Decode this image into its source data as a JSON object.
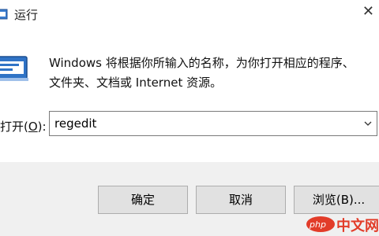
{
  "window": {
    "title": "运行",
    "close_glyph": "✕"
  },
  "icons": {
    "title_icon": "run-dialog-icon",
    "main_icon": "run-program-icon",
    "dropdown": "chevron-down-icon",
    "close": "close-icon"
  },
  "content": {
    "description_line1": "Windows 将根据你所输入的名称，为你打开相应的程序、",
    "description_line2": "文件夹、文档或 Internet 资源。",
    "open_label": "打开(",
    "open_label_accel": "O",
    "open_label_end": "):",
    "input_value": "regedit"
  },
  "buttons": {
    "ok": "确定",
    "cancel": "取消",
    "browse": "浏览(B)..."
  },
  "watermark": {
    "badge": "php",
    "text": "中文网"
  },
  "colors": {
    "footer_bg": "#f0f0f0",
    "button_bg": "#e1e1e1",
    "watermark": "#e23c29"
  }
}
